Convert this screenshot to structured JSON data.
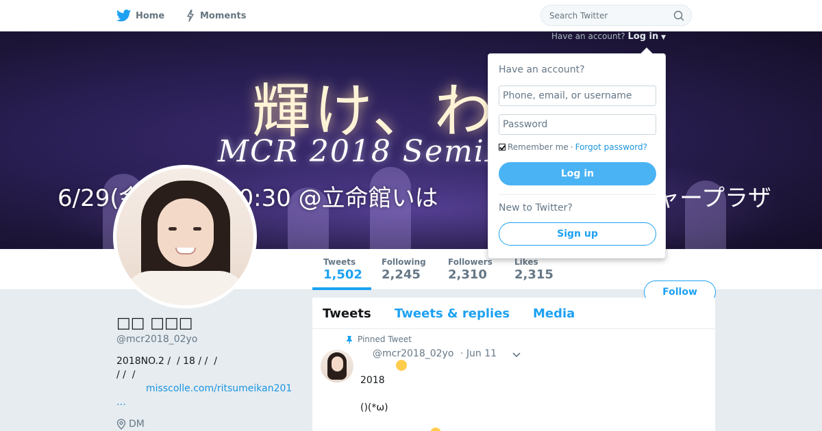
{
  "nav": {
    "home_label": "Home",
    "moments_label": "Moments",
    "search_placeholder": "Search Twitter",
    "login_prompt": "Have an account?",
    "login_link": "Log in"
  },
  "banner": {
    "title": "輝け、わ",
    "subtitle": "MCR 2018 SemiF",
    "date_line": "6/29(金)",
    "date_time": "〜20:30 @立命館いは",
    "date_tail": "ャープラザ"
  },
  "stats": [
    {
      "label": "Tweets",
      "value": "1,502"
    },
    {
      "label": "Following",
      "value": "2,245"
    },
    {
      "label": "Followers",
      "value": "2,310"
    },
    {
      "label": "Likes",
      "value": "2,315"
    }
  ],
  "follow_label": "Follow",
  "profile": {
    "name": "□□ □□□",
    "handle": "@mcr2018_02yo",
    "bio_line1": "2018NO.2 /  / 18 / /  /",
    "bio_line2": "/ /  /",
    "link": "misscolle.com/ritsumeikan201",
    "ellipsis": "…",
    "location": "DM"
  },
  "timeline": {
    "tabs": [
      "Tweets",
      "Tweets & replies",
      "Media"
    ],
    "pinned_label": "Pinned Tweet",
    "tweet": {
      "handle": "@mcr2018_02yo",
      "date": "· Jun 11",
      "line1": "2018",
      "line2": "()(*ω)"
    }
  },
  "login_dropdown": {
    "title": "Have an account?",
    "username_placeholder": "Phone, email, or username",
    "password_placeholder": "Password",
    "remember_label": "Remember me",
    "separator": "·",
    "forgot_label": "Forgot password?",
    "login_button": "Log in",
    "new_label": "New to Twitter?",
    "signup_button": "Sign up"
  },
  "colors": {
    "accent": "#1da1f2",
    "login_button": "#4ab3f4",
    "background": "#e6ecf0"
  }
}
